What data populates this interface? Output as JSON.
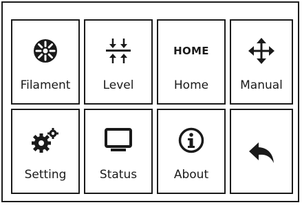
{
  "menu": {
    "tiles": [
      {
        "label": "Filament",
        "icon": "filament-icon"
      },
      {
        "label": "Level",
        "icon": "level-icon"
      },
      {
        "label": "Home",
        "icon": "home-text-icon",
        "icon_text": "HOME"
      },
      {
        "label": "Manual",
        "icon": "move-arrows-icon"
      },
      {
        "label": "Setting",
        "icon": "gears-icon"
      },
      {
        "label": "Status",
        "icon": "monitor-icon"
      },
      {
        "label": "About",
        "icon": "info-icon"
      },
      {
        "label": "",
        "icon": "back-arrow-icon"
      }
    ]
  },
  "colors": {
    "foreground": "#1a1a1a",
    "background": "#ffffff"
  }
}
